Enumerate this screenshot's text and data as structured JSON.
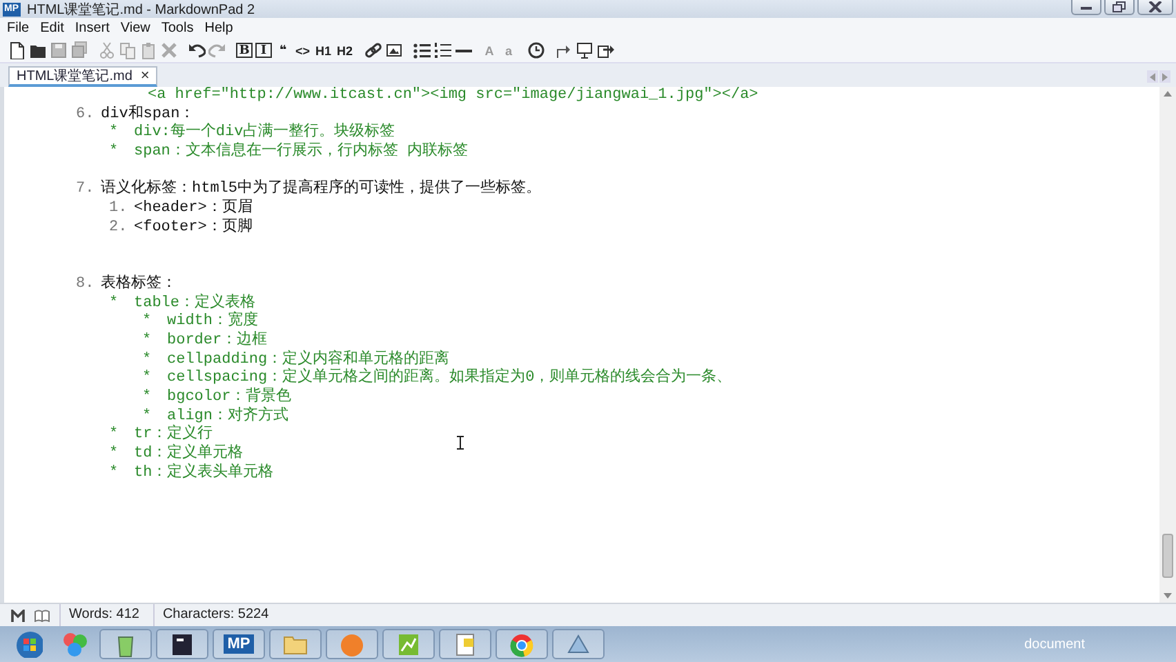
{
  "window": {
    "title": "HTML课堂笔记.md - MarkdownPad 2",
    "app_badge": "MP"
  },
  "menu": [
    {
      "label": "File"
    },
    {
      "label": "Edit"
    },
    {
      "label": "Insert"
    },
    {
      "label": "View"
    },
    {
      "label": "Tools"
    },
    {
      "label": "Help"
    }
  ],
  "toolbar": [
    {
      "kind": "new"
    },
    {
      "kind": "open"
    },
    {
      "kind": "save"
    },
    {
      "kind": "saveall"
    },
    {
      "kind": "sep"
    },
    {
      "kind": "cut"
    },
    {
      "kind": "copy"
    },
    {
      "kind": "paste"
    },
    {
      "kind": "delete"
    },
    {
      "kind": "sep"
    },
    {
      "kind": "undo"
    },
    {
      "kind": "redo"
    },
    {
      "kind": "sep"
    },
    {
      "kind": "text",
      "label": "B",
      "boxed": true
    },
    {
      "kind": "text",
      "label": "I",
      "boxed": true
    },
    {
      "kind": "text",
      "label": "❝"
    },
    {
      "kind": "text",
      "label": "<>"
    },
    {
      "kind": "text",
      "label": "H1"
    },
    {
      "kind": "text",
      "label": "H2"
    },
    {
      "kind": "sep"
    },
    {
      "kind": "link"
    },
    {
      "kind": "image"
    },
    {
      "kind": "sep"
    },
    {
      "kind": "bullets"
    },
    {
      "kind": "numbers"
    },
    {
      "kind": "rule"
    },
    {
      "kind": "sep"
    },
    {
      "kind": "text",
      "label": "A",
      "dim": true
    },
    {
      "kind": "text",
      "label": "a",
      "dim": true
    },
    {
      "kind": "sep"
    },
    {
      "kind": "clock"
    },
    {
      "kind": "sep"
    },
    {
      "kind": "upload"
    },
    {
      "kind": "preview"
    },
    {
      "kind": "export"
    }
  ],
  "tabs": [
    {
      "label": "HTML课堂笔记.md",
      "selected": true,
      "close": "×"
    }
  ],
  "editor": {
    "lines": [
      {
        "kind": "code",
        "text": "<a href=\"http://www.itcast.cn\"><img src=\"image/jiangwai_1.jpg\"></a>"
      },
      {
        "kind": "numbered",
        "marker": "6.",
        "text": "div和span：",
        "children": [
          {
            "kind": "bullet",
            "marker": "*",
            "text": "div:每一个div占满一整行。块级标签"
          },
          {
            "kind": "bullet",
            "marker": "*",
            "text": "span：文本信息在一行展示，行内标签 内联标签"
          }
        ]
      },
      {
        "kind": "blank"
      },
      {
        "kind": "numbered",
        "marker": "7.",
        "text": "语义化标签：html5中为了提高程序的可读性，提供了一些标签。",
        "children": [
          {
            "kind": "numbered",
            "marker": "1.",
            "text": "<header>：页眉"
          },
          {
            "kind": "numbered",
            "marker": "2.",
            "text": "<footer>：页脚"
          }
        ]
      },
      {
        "kind": "blank"
      },
      {
        "kind": "blank"
      },
      {
        "kind": "numbered",
        "marker": "8.",
        "text": "表格标签：",
        "children": [
          {
            "kind": "bullet",
            "marker": "*",
            "text": "table：定义表格",
            "children": [
              {
                "kind": "bullet",
                "marker": "*",
                "text": "width：宽度"
              },
              {
                "kind": "bullet",
                "marker": "*",
                "text": "border：边框"
              },
              {
                "kind": "bullet",
                "marker": "*",
                "text": "cellpadding：定义内容和单元格的距离"
              },
              {
                "kind": "bullet",
                "marker": "*",
                "text": "cellspacing：定义单元格之间的距离。如果指定为0，则单元格的线会合为一条、"
              },
              {
                "kind": "bullet",
                "marker": "*",
                "text": "bgcolor：背景色"
              },
              {
                "kind": "bullet",
                "marker": "*",
                "text": "align：对齐方式"
              }
            ]
          },
          {
            "kind": "bullet",
            "marker": "*",
            "text": "tr：定义行"
          },
          {
            "kind": "bullet",
            "marker": "*",
            "text": "td：定义单元格"
          },
          {
            "kind": "bullet",
            "marker": "*",
            "text": "th：定义表头单元格"
          }
        ]
      }
    ]
  },
  "status_bar": {
    "words": "Words: 412",
    "characters": "Characters: 5224"
  },
  "taskbar": {
    "apps": [
      {
        "kind": "start"
      },
      {
        "kind": "balls"
      },
      {
        "kind": "bin"
      },
      {
        "kind": "dark"
      },
      {
        "kind": "mp",
        "label": "MP"
      },
      {
        "kind": "folder"
      },
      {
        "kind": "orange"
      },
      {
        "kind": "green"
      },
      {
        "kind": "note"
      },
      {
        "kind": "chrome"
      },
      {
        "kind": "paint"
      }
    ],
    "tray_text": "document"
  }
}
